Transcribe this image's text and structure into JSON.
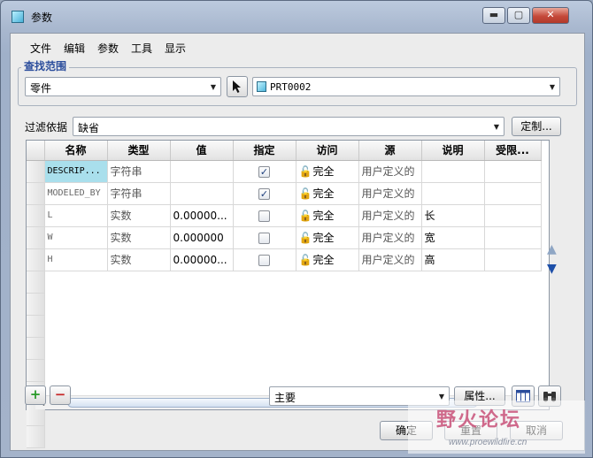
{
  "window": {
    "title": "参数",
    "min_label": "▬",
    "max_label": "▢",
    "close_label": "✕"
  },
  "menu": [
    "文件",
    "编辑",
    "参数",
    "工具",
    "显示"
  ],
  "search_scope": {
    "legend": "查找范围",
    "type_value": "零件",
    "model_value": "PRT0002"
  },
  "filter": {
    "label": "过滤依据",
    "value": "缺省",
    "customize_label": "定制..."
  },
  "table": {
    "columns": [
      "名称",
      "类型",
      "值",
      "指定",
      "访问",
      "源",
      "说明",
      "受限..."
    ],
    "rows": [
      {
        "name": "DESCRIP...",
        "type": "字符串",
        "value": "",
        "designate": true,
        "access": "完全",
        "source": "用户定义的",
        "desc": ""
      },
      {
        "name": "MODELED_BY",
        "type": "字符串",
        "value": "",
        "designate": true,
        "access": "完全",
        "source": "用户定义的",
        "desc": ""
      },
      {
        "name": "L",
        "type": "实数",
        "value": "0.00000...",
        "designate": false,
        "access": "完全",
        "source": "用户定义的",
        "desc": "长"
      },
      {
        "name": "W",
        "type": "实数",
        "value": "0.000000",
        "designate": false,
        "access": "完全",
        "source": "用户定义的",
        "desc": "宽"
      },
      {
        "name": "H",
        "type": "实数",
        "value": "0.00000...",
        "designate": false,
        "access": "完全",
        "source": "用户定义的",
        "desc": "高"
      }
    ]
  },
  "bottom": {
    "add_label": "+",
    "remove_label": "−",
    "view_value": "主要",
    "properties_label": "属性..."
  },
  "actions": {
    "ok_label": "确定",
    "reset_label": "重置",
    "cancel_label": "取消"
  },
  "watermark": {
    "logo": "野火论坛",
    "url": "www.proewildfire.cn"
  },
  "colors": {
    "legend": "#2b4d9c",
    "selected_cell": "#a9dfec",
    "add_green": "#2a9a2a",
    "remove_red": "#c62828",
    "arrow_blue": "#1d4fa8"
  }
}
